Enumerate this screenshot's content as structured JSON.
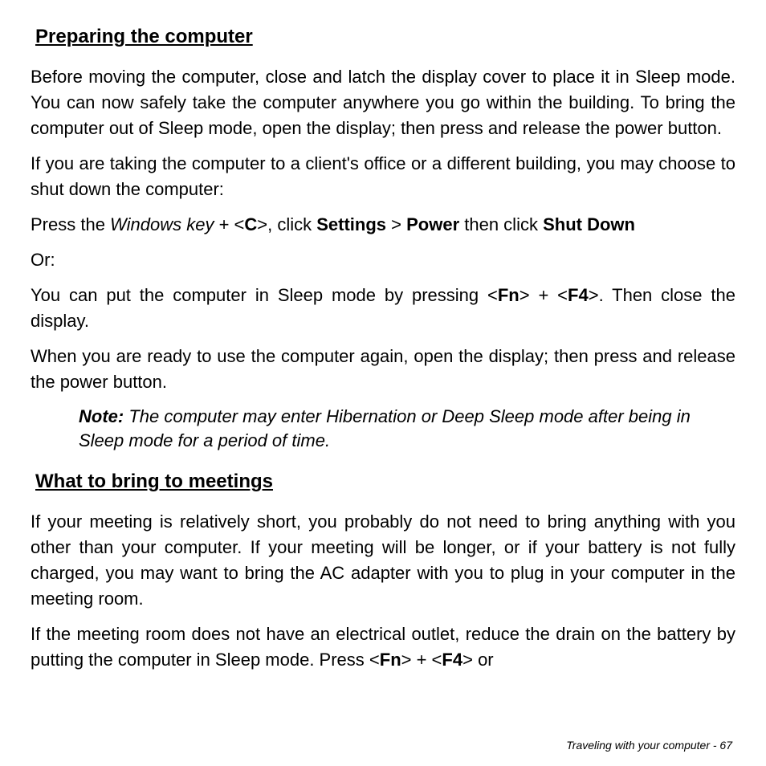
{
  "section1": {
    "heading": "Preparing the computer",
    "p1": "Before moving the computer, close and latch the display cover to place it in Sleep mode. You can now safely take the computer anywhere you go within the building. To bring the computer out of Sleep mode, open the display; then press and release the power button.",
    "p2": "If you are taking the computer to a client's office or a different building, you may choose to shut down the computer:",
    "p3": {
      "t1": "Press the ",
      "key": "Windows key",
      "t2": " + <",
      "c": "C",
      "t3": ">, click ",
      "settings": "Settings",
      "t4": " > ",
      "power": "Power",
      "t5": " then click ",
      "shutdown": "Shut Down"
    },
    "or": "Or:",
    "p4": {
      "t1": "You can put the computer in Sleep mode by pressing <",
      "fn": "Fn",
      "t2": "> + <",
      "f4": "F4",
      "t3": ">. Then close the display."
    },
    "p5": "When you are ready to use the computer again, open the display; then press and release the power button.",
    "note": {
      "label": "Note:",
      "text": " The computer may enter Hibernation or Deep Sleep mode after being in Sleep mode for a period of time."
    }
  },
  "section2": {
    "heading": "What to bring to meetings",
    "p1": "If your meeting is relatively short, you probably do not need to bring anything with you other than your computer. If your meeting will be longer, or if your battery is not fully charged, you may want to bring the AC adapter with you to plug in your computer in the meeting room.",
    "p2": {
      "t1": "If the meeting room does not have an electrical outlet, reduce the drain on the battery by putting the computer in Sleep mode. Press <",
      "fn": "Fn",
      "t2": "> + <",
      "f4": "F4",
      "t3": "> or"
    }
  },
  "footer": {
    "text": "Traveling with your computer -  67"
  }
}
